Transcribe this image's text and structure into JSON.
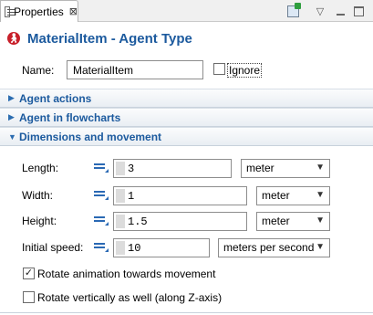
{
  "tab": {
    "title": "Properties",
    "close_glyph": "⊠"
  },
  "toolbar": {
    "icons": [
      "pin-view-icon",
      "view-menu-icon",
      "minimize-icon",
      "maximize-icon"
    ],
    "menu_glyph": "▽"
  },
  "header": {
    "icon": "agent-type-icon",
    "title": "MaterialItem - Agent Type"
  },
  "name": {
    "label": "Name:",
    "value": "MaterialItem"
  },
  "ignore": {
    "label": "Ignore",
    "checked": false
  },
  "sections": [
    {
      "label": "Agent actions",
      "expanded": false,
      "arrow": "▶"
    },
    {
      "label": "Agent in flowcharts",
      "expanded": false,
      "arrow": "▶"
    },
    {
      "label": "Dimensions and movement",
      "expanded": true,
      "arrow": "▼"
    }
  ],
  "fields": [
    {
      "label": "Length:",
      "value": "3",
      "unit": "meter"
    },
    {
      "label": "Width:",
      "value": "1",
      "unit": "meter"
    },
    {
      "label": "Height:",
      "value": "1.5",
      "unit": "meter"
    },
    {
      "label": "Initial speed:",
      "value": "10",
      "unit": "meters per second"
    }
  ],
  "caret_glyph": "▼",
  "rotate_animation": {
    "label": "Rotate animation towards movement",
    "checked": true,
    "mark": "✓"
  },
  "rotate_vertical": {
    "label": "Rotate vertically as well (along Z-axis)",
    "checked": false
  },
  "colors": {
    "accent": "#1c5a9e",
    "section_bg": "#e9eef3",
    "field_icon": "#2a69b4",
    "header_icon": "#c8202a"
  }
}
